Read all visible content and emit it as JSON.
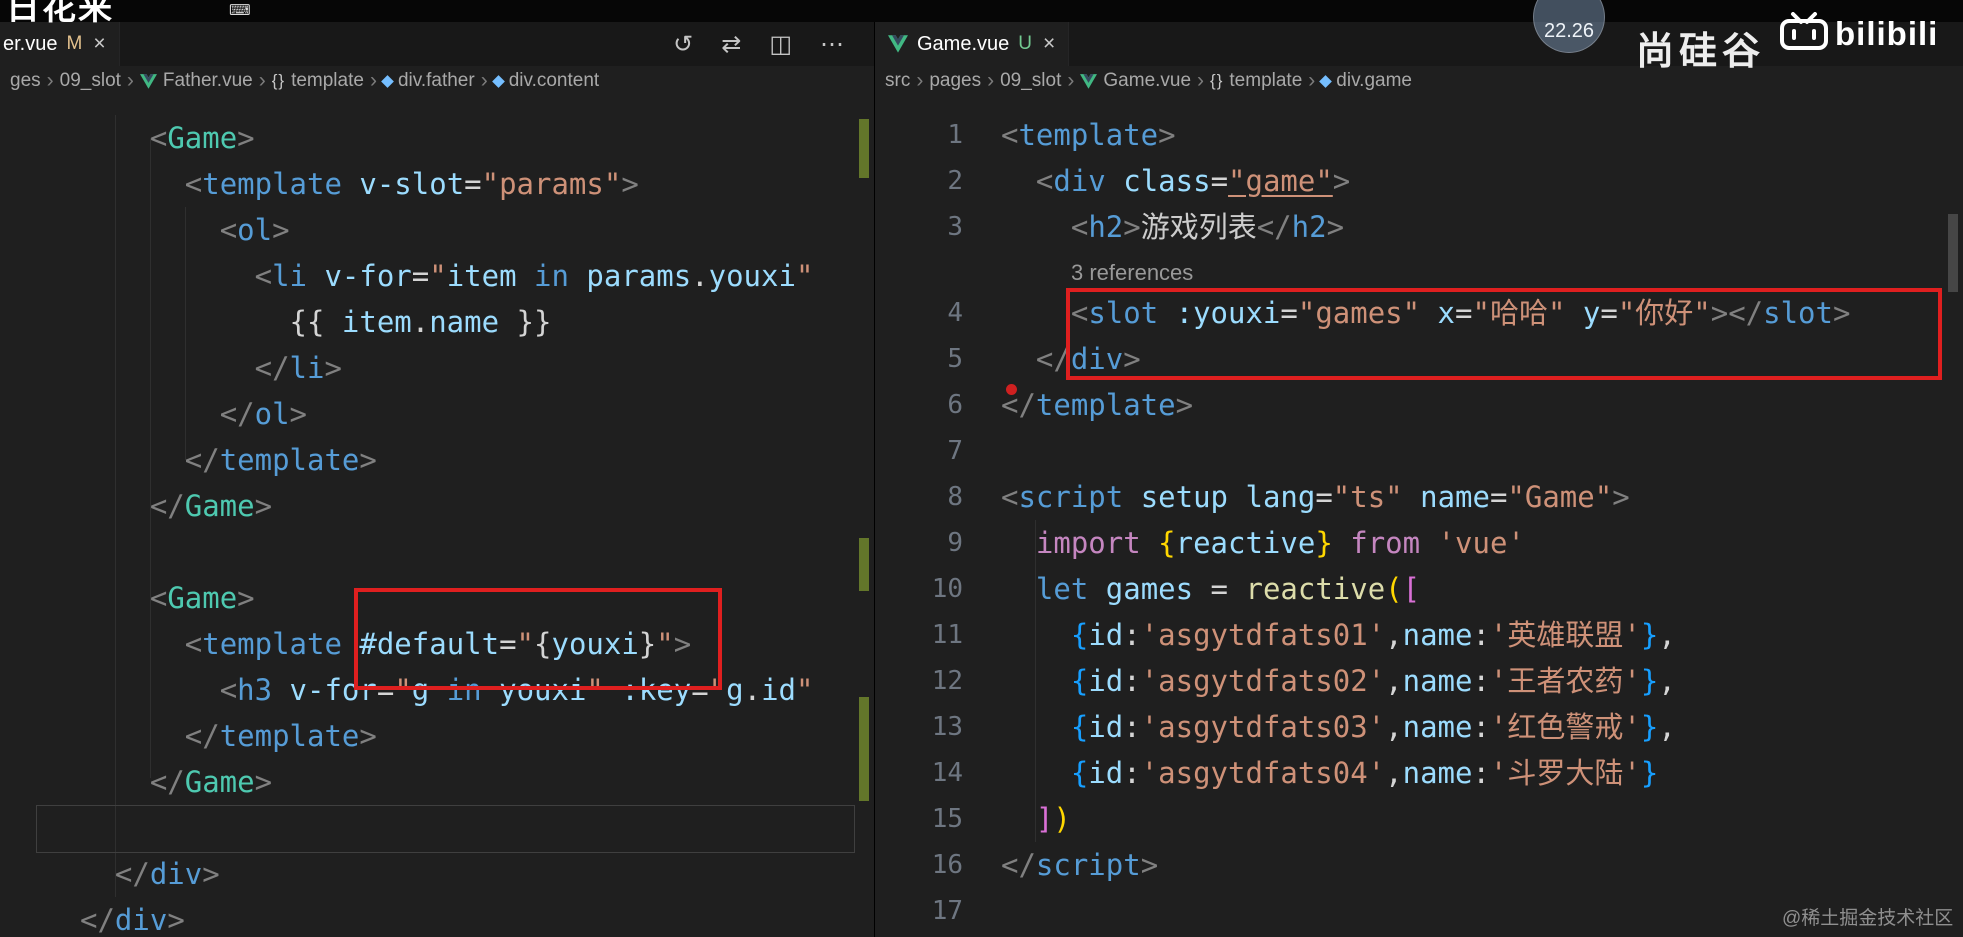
{
  "overlays": {
    "clock": "22.26",
    "brand": "尚硅谷",
    "bilibili": "bilibili",
    "watermark": "@稀土掘金技术社区",
    "scribble": "日花来",
    "titlebar_glyph": "⌨"
  },
  "left_pane": {
    "tab": {
      "label": "er.vue",
      "git_status": "M",
      "close": "×"
    },
    "actions": [
      {
        "name": "timeline-history",
        "glyph": "↺"
      },
      {
        "name": "open-changes",
        "glyph": "⇄"
      },
      {
        "name": "split-editor",
        "glyph": "◫"
      },
      {
        "name": "more-actions",
        "glyph": "⋯"
      }
    ],
    "breadcrumbs": [
      {
        "label": "ges"
      },
      {
        "label": "09_slot"
      },
      {
        "icon": "vue",
        "label": "Father.vue"
      },
      {
        "icon": "braces",
        "label": "template"
      },
      {
        "icon": "symbol",
        "label": "div.father"
      },
      {
        "icon": "symbol",
        "label": "div.content"
      }
    ],
    "lines": [
      {
        "tokens": [
          [
            "ws",
            "    "
          ],
          [
            "p",
            "<"
          ],
          [
            "comp",
            "Game"
          ],
          [
            "p",
            ">"
          ]
        ]
      },
      {
        "tokens": [
          [
            "ws",
            "      "
          ],
          [
            "p",
            "<"
          ],
          [
            "t",
            "template"
          ],
          [
            "o",
            " "
          ],
          [
            "a",
            "v-slot"
          ],
          [
            "o",
            "="
          ],
          [
            "s",
            "\"params\""
          ],
          [
            "p",
            ">"
          ]
        ]
      },
      {
        "tokens": [
          [
            "ws",
            "        "
          ],
          [
            "p",
            "<"
          ],
          [
            "t",
            "ol"
          ],
          [
            "p",
            ">"
          ]
        ]
      },
      {
        "tokens": [
          [
            "ws",
            "          "
          ],
          [
            "p",
            "<"
          ],
          [
            "t",
            "li"
          ],
          [
            "o",
            " "
          ],
          [
            "a",
            "v-for"
          ],
          [
            "o",
            "="
          ],
          [
            "s",
            "\""
          ],
          [
            "a",
            "item"
          ],
          [
            "k2",
            " in "
          ],
          [
            "a",
            "params"
          ],
          [
            "o",
            "."
          ],
          [
            "a",
            "youxi"
          ],
          [
            "s",
            "\""
          ]
        ]
      },
      {
        "tokens": [
          [
            "ws",
            "            "
          ],
          [
            "o",
            "{{ "
          ],
          [
            "a",
            "item"
          ],
          [
            "o",
            "."
          ],
          [
            "a",
            "name"
          ],
          [
            "o",
            " }}"
          ]
        ]
      },
      {
        "tokens": [
          [
            "ws",
            "          "
          ],
          [
            "p",
            "</"
          ],
          [
            "t",
            "li"
          ],
          [
            "p",
            ">"
          ]
        ]
      },
      {
        "tokens": [
          [
            "ws",
            "        "
          ],
          [
            "p",
            "</"
          ],
          [
            "t",
            "ol"
          ],
          [
            "p",
            ">"
          ]
        ]
      },
      {
        "tokens": [
          [
            "ws",
            "      "
          ],
          [
            "p",
            "</"
          ],
          [
            "t",
            "template"
          ],
          [
            "p",
            ">"
          ]
        ]
      },
      {
        "tokens": [
          [
            "ws",
            "    "
          ],
          [
            "p",
            "</"
          ],
          [
            "comp",
            "Game"
          ],
          [
            "p",
            ">"
          ]
        ]
      },
      {
        "tokens": []
      },
      {
        "tokens": [
          [
            "ws",
            "    "
          ],
          [
            "p",
            "<"
          ],
          [
            "comp",
            "Game"
          ],
          [
            "p",
            ">"
          ]
        ]
      },
      {
        "tokens": [
          [
            "ws",
            "      "
          ],
          [
            "p",
            "<"
          ],
          [
            "t",
            "template"
          ],
          [
            "o",
            " "
          ],
          [
            "a",
            "#default"
          ],
          [
            "o",
            "="
          ],
          [
            "s",
            "\""
          ],
          [
            "o",
            "{"
          ],
          [
            "a",
            "youxi"
          ],
          [
            "o",
            "}"
          ],
          [
            "s",
            "\""
          ],
          [
            "p",
            ">"
          ]
        ]
      },
      {
        "tokens": [
          [
            "ws",
            "        "
          ],
          [
            "p",
            "<"
          ],
          [
            "t",
            "h3"
          ],
          [
            "o",
            " "
          ],
          [
            "a",
            "v-for"
          ],
          [
            "o",
            "="
          ],
          [
            "s",
            "\""
          ],
          [
            "a",
            "g"
          ],
          [
            "k2",
            " in "
          ],
          [
            "a",
            "youxi"
          ],
          [
            "s",
            "\""
          ],
          [
            "o",
            " "
          ],
          [
            "a",
            ":key"
          ],
          [
            "o",
            "="
          ],
          [
            "s",
            "\""
          ],
          [
            "a",
            "g"
          ],
          [
            "o",
            "."
          ],
          [
            "a",
            "id"
          ],
          [
            "s",
            "\""
          ]
        ]
      },
      {
        "tokens": [
          [
            "ws",
            "      "
          ],
          [
            "p",
            "</"
          ],
          [
            "t",
            "template"
          ],
          [
            "p",
            ">"
          ]
        ]
      },
      {
        "tokens": [
          [
            "ws",
            "    "
          ],
          [
            "p",
            "</"
          ],
          [
            "comp",
            "Game"
          ],
          [
            "p",
            ">"
          ]
        ]
      },
      {
        "tokens": []
      },
      {
        "tokens": [
          [
            "ws",
            "  "
          ],
          [
            "p",
            "</"
          ],
          [
            "t",
            "div"
          ],
          [
            "p",
            ">"
          ]
        ]
      },
      {
        "tokens": [
          [
            "p",
            "</"
          ],
          [
            "t",
            "div"
          ],
          [
            "p",
            ">"
          ]
        ]
      }
    ]
  },
  "right_pane": {
    "tab": {
      "label": "Game.vue",
      "git_status": "U",
      "close": "×"
    },
    "breadcrumbs": [
      {
        "label": "src"
      },
      {
        "label": "pages"
      },
      {
        "label": "09_slot"
      },
      {
        "icon": "vue",
        "label": "Game.vue"
      },
      {
        "icon": "braces",
        "label": "template"
      },
      {
        "icon": "symbol",
        "label": "div.game"
      }
    ],
    "codelens": "3 references",
    "lines": [
      {
        "num": 1,
        "tokens": [
          [
            "p",
            "<"
          ],
          [
            "t",
            "template"
          ],
          [
            "p",
            ">"
          ]
        ]
      },
      {
        "num": 2,
        "tokens": [
          [
            "ws",
            "  "
          ],
          [
            "p",
            "<"
          ],
          [
            "t",
            "div"
          ],
          [
            "o",
            " "
          ],
          [
            "a",
            "class"
          ],
          [
            "o",
            "="
          ],
          [
            "su",
            "\"game\""
          ],
          [
            "p",
            ">"
          ]
        ]
      },
      {
        "num": 3,
        "tokens": [
          [
            "ws",
            "    "
          ],
          [
            "p",
            "<"
          ],
          [
            "t",
            "h2"
          ],
          [
            "p",
            ">"
          ],
          [
            "txt",
            "游戏列表"
          ],
          [
            "p",
            "</"
          ],
          [
            "t",
            "h2"
          ],
          [
            "p",
            ">"
          ]
        ]
      },
      {
        "codelens": "3 references"
      },
      {
        "num": 4,
        "tokens": [
          [
            "ws",
            "    "
          ],
          [
            "p",
            "<"
          ],
          [
            "t",
            "slot"
          ],
          [
            "o",
            " "
          ],
          [
            "a",
            ":youxi"
          ],
          [
            "o",
            "="
          ],
          [
            "s",
            "\"games\""
          ],
          [
            "o",
            " "
          ],
          [
            "a",
            "x"
          ],
          [
            "o",
            "="
          ],
          [
            "s",
            "\"哈哈\""
          ],
          [
            "o",
            " "
          ],
          [
            "a",
            "y"
          ],
          [
            "o",
            "="
          ],
          [
            "s",
            "\"你好\""
          ],
          [
            "p",
            ">"
          ],
          [
            "p",
            "</"
          ],
          [
            "t",
            "slot"
          ],
          [
            "p",
            ">"
          ]
        ]
      },
      {
        "num": 5,
        "tokens": [
          [
            "ws",
            "  "
          ],
          [
            "p",
            "</"
          ],
          [
            "t",
            "div"
          ],
          [
            "p",
            ">"
          ]
        ]
      },
      {
        "num": 6,
        "tokens": [
          [
            "p",
            "</"
          ],
          [
            "t",
            "template"
          ],
          [
            "p",
            ">"
          ]
        ]
      },
      {
        "num": 7,
        "tokens": []
      },
      {
        "num": 8,
        "tokens": [
          [
            "p",
            "<"
          ],
          [
            "t",
            "script"
          ],
          [
            "o",
            " "
          ],
          [
            "a",
            "setup"
          ],
          [
            "o",
            " "
          ],
          [
            "a",
            "lang"
          ],
          [
            "o",
            "="
          ],
          [
            "s",
            "\"ts\""
          ],
          [
            "o",
            " "
          ],
          [
            "a",
            "name"
          ],
          [
            "o",
            "="
          ],
          [
            "s",
            "\"Game\""
          ],
          [
            "p",
            ">"
          ]
        ]
      },
      {
        "num": 9,
        "tokens": [
          [
            "ws",
            "  "
          ],
          [
            "k",
            "import"
          ],
          [
            "o",
            " "
          ],
          [
            "b1",
            "{"
          ],
          [
            "a",
            "reactive"
          ],
          [
            "b1",
            "}"
          ],
          [
            "o",
            " "
          ],
          [
            "k",
            "from"
          ],
          [
            "o",
            " "
          ],
          [
            "s",
            "'vue'"
          ]
        ]
      },
      {
        "num": 10,
        "tokens": [
          [
            "ws",
            "  "
          ],
          [
            "k2",
            "let"
          ],
          [
            "o",
            " "
          ],
          [
            "a",
            "games"
          ],
          [
            "o",
            " = "
          ],
          [
            "fn",
            "reactive"
          ],
          [
            "b1",
            "("
          ],
          [
            "b2",
            "["
          ]
        ]
      },
      {
        "num": 11,
        "tokens": [
          [
            "ws",
            "    "
          ],
          [
            "b3",
            "{"
          ],
          [
            "a",
            "id"
          ],
          [
            "o",
            ":"
          ],
          [
            "s",
            "'asgytdfats01'"
          ],
          [
            "o",
            ","
          ],
          [
            "a",
            "name"
          ],
          [
            "o",
            ":"
          ],
          [
            "s",
            "'英雄联盟'"
          ],
          [
            "b3",
            "}"
          ],
          [
            "o",
            ","
          ]
        ]
      },
      {
        "num": 12,
        "tokens": [
          [
            "ws",
            "    "
          ],
          [
            "b3",
            "{"
          ],
          [
            "a",
            "id"
          ],
          [
            "o",
            ":"
          ],
          [
            "s",
            "'asgytdfats02'"
          ],
          [
            "o",
            ","
          ],
          [
            "a",
            "name"
          ],
          [
            "o",
            ":"
          ],
          [
            "s",
            "'王者农药'"
          ],
          [
            "b3",
            "}"
          ],
          [
            "o",
            ","
          ]
        ]
      },
      {
        "num": 13,
        "tokens": [
          [
            "ws",
            "    "
          ],
          [
            "b3",
            "{"
          ],
          [
            "a",
            "id"
          ],
          [
            "o",
            ":"
          ],
          [
            "s",
            "'asgytdfats03'"
          ],
          [
            "o",
            ","
          ],
          [
            "a",
            "name"
          ],
          [
            "o",
            ":"
          ],
          [
            "s",
            "'红色警戒'"
          ],
          [
            "b3",
            "}"
          ],
          [
            "o",
            ","
          ]
        ]
      },
      {
        "num": 14,
        "tokens": [
          [
            "ws",
            "    "
          ],
          [
            "b3",
            "{"
          ],
          [
            "a",
            "id"
          ],
          [
            "o",
            ":"
          ],
          [
            "s",
            "'asgytdfats04'"
          ],
          [
            "o",
            ","
          ],
          [
            "a",
            "name"
          ],
          [
            "o",
            ":"
          ],
          [
            "s",
            "'斗罗大陆'"
          ],
          [
            "b3",
            "}"
          ]
        ]
      },
      {
        "num": 15,
        "tokens": [
          [
            "ws",
            "  "
          ],
          [
            "b2",
            "]"
          ],
          [
            "b1",
            ")"
          ]
        ]
      },
      {
        "num": 16,
        "tokens": [
          [
            "p",
            "</"
          ],
          [
            "t",
            "script"
          ],
          [
            "p",
            ">"
          ]
        ]
      },
      {
        "num": 17,
        "tokens": []
      }
    ]
  }
}
